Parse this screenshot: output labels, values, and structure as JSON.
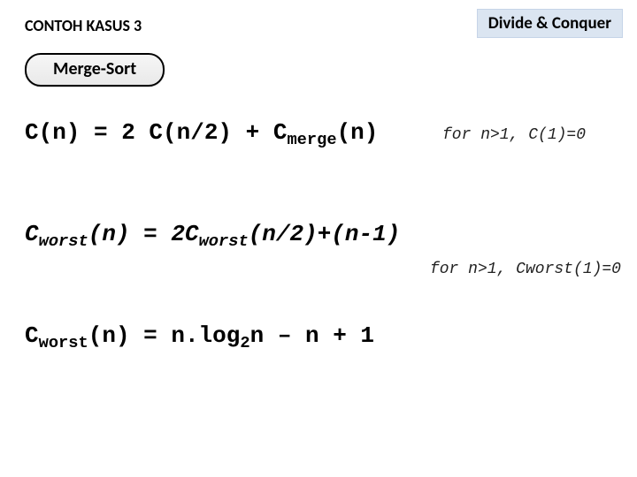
{
  "header": {
    "title": "CONTOH KASUS 3",
    "badge": "Divide & Conquer"
  },
  "pill": {
    "label": "Merge-Sort"
  },
  "eq1": {
    "pre": "C(n) = 2 C(n/2) + C",
    "sub": "merge",
    "post": "(n)",
    "cond": "for n>1, C(1)=0"
  },
  "eq2": {
    "a_pre": "C",
    "a_sub": "worst",
    "a_mid": "(n) = 2C",
    "b_sub": "worst",
    "b_post": "(n/2)+(n-1)",
    "cond": "for n>1, Cworst(1)=0"
  },
  "eq3": {
    "a_pre": "C",
    "a_sub": "worst",
    "a_mid": "(n) = n.log",
    "b_sub": "2",
    "b_post": "n – n + 1"
  }
}
